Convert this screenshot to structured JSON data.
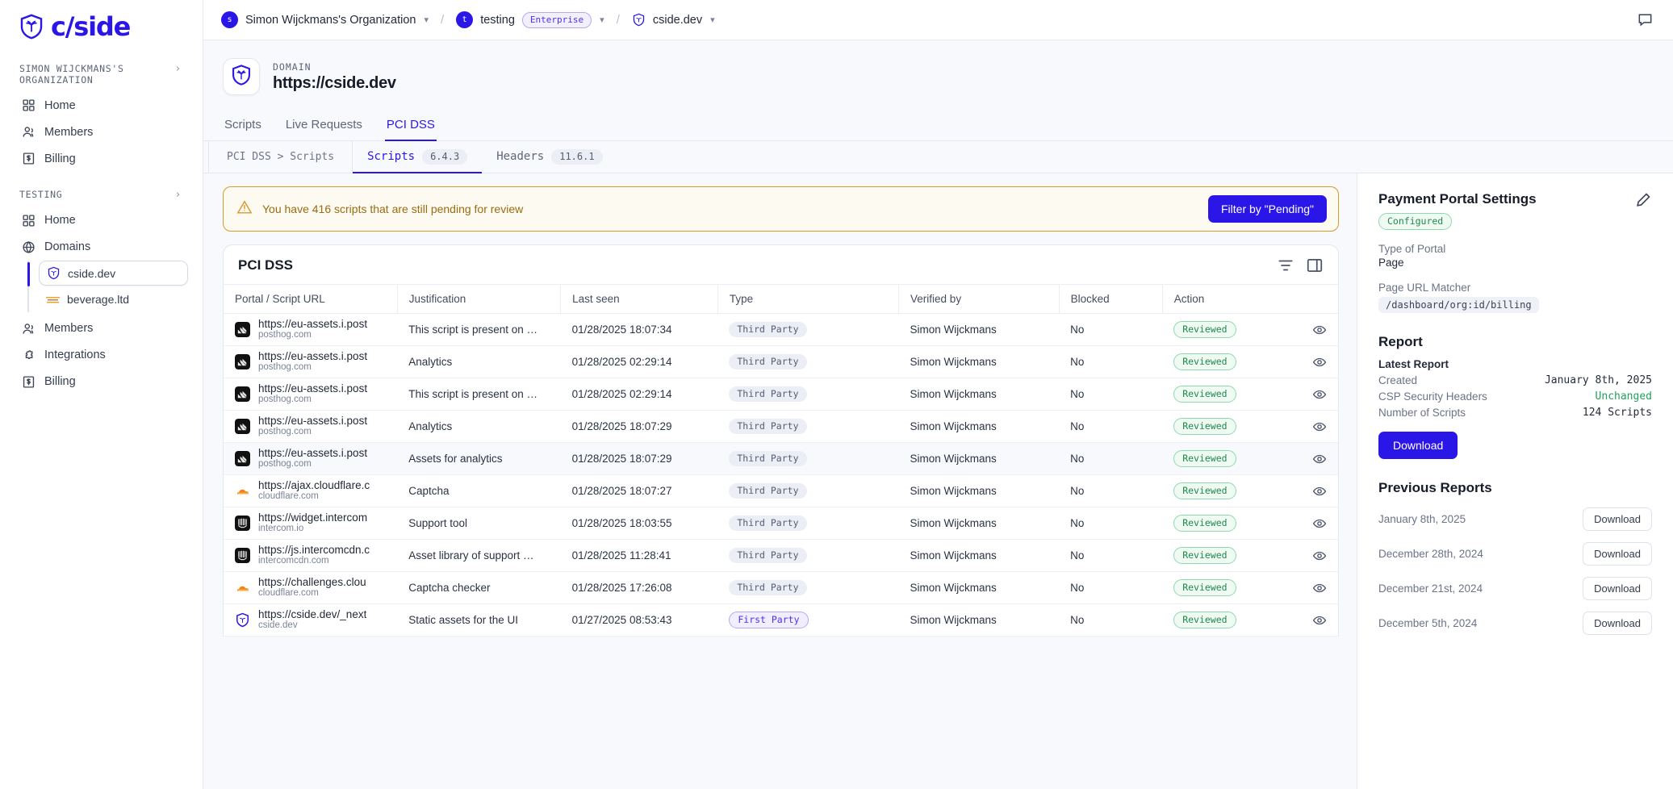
{
  "sidebar": {
    "logo_text": "c/side",
    "org_section": {
      "label": "SIMON WIJCKMANS'S ORGANIZATION"
    },
    "org_items": [
      {
        "label": "Home",
        "icon": "grid-icon"
      },
      {
        "label": "Members",
        "icon": "people-icon"
      },
      {
        "label": "Billing",
        "icon": "receipt-dollar-icon"
      }
    ],
    "project_section": {
      "label": "TESTING"
    },
    "project_items": [
      {
        "label": "Home",
        "icon": "grid-icon"
      },
      {
        "label": "Domains",
        "icon": "globe-icon"
      }
    ],
    "domains": [
      {
        "label": "cside.dev",
        "icon": "cside-shield-icon",
        "active": true
      },
      {
        "label": "beverage.ltd",
        "icon": "beverage-favicon",
        "active": false
      }
    ],
    "project_items_2": [
      {
        "label": "Members",
        "icon": "people-icon"
      },
      {
        "label": "Integrations",
        "icon": "puzzle-icon"
      },
      {
        "label": "Billing",
        "icon": "receipt-dollar-icon"
      }
    ]
  },
  "topbar": {
    "org": {
      "initial": "s",
      "name": "Simon Wijckmans's Organization"
    },
    "project": {
      "initial": "t",
      "name": "testing",
      "plan": "Enterprise"
    },
    "domain": {
      "name": "cside.dev"
    },
    "separator": "/",
    "feedback_icon": "feedback-icon"
  },
  "page": {
    "kicker": "DOMAIN",
    "title": "https://cside.dev",
    "tabs": [
      {
        "label": "Scripts",
        "active": false
      },
      {
        "label": "Live Requests",
        "active": false
      },
      {
        "label": "PCI DSS",
        "active": true
      }
    ],
    "subcrumb": "PCI DSS > Scripts",
    "subtabs": [
      {
        "label": "Scripts",
        "chip": "6.4.3",
        "active": true
      },
      {
        "label": "Headers",
        "chip": "11.6.1",
        "active": false
      }
    ]
  },
  "banner": {
    "icon": "warning-triangle-icon",
    "text": "You have 416 scripts that are still pending for review",
    "button": "Filter by \"Pending\""
  },
  "table": {
    "title": "PCI DSS",
    "tools": [
      {
        "name": "filter-icon"
      },
      {
        "name": "panel-toggle-icon"
      }
    ],
    "columns": [
      "Portal / Script URL",
      "Justification",
      "Last seen",
      "Type",
      "Verified by",
      "Blocked",
      "Action"
    ],
    "rows": [
      {
        "url": "https://eu-assets.i.post",
        "host": "posthog.com",
        "favicon": "posthog-icon",
        "justification": "This script is present on …",
        "last_seen": "01/28/2025 18:07:34",
        "type": "Third Party",
        "verified_by": "Simon Wijckmans",
        "blocked": "No",
        "action": "Reviewed"
      },
      {
        "url": "https://eu-assets.i.post",
        "host": "posthog.com",
        "favicon": "posthog-icon",
        "justification": "Analytics",
        "last_seen": "01/28/2025 02:29:14",
        "type": "Third Party",
        "verified_by": "Simon Wijckmans",
        "blocked": "No",
        "action": "Reviewed"
      },
      {
        "url": "https://eu-assets.i.post",
        "host": "posthog.com",
        "favicon": "posthog-icon",
        "justification": "This script is present on …",
        "last_seen": "01/28/2025 02:29:14",
        "type": "Third Party",
        "verified_by": "Simon Wijckmans",
        "blocked": "No",
        "action": "Reviewed"
      },
      {
        "url": "https://eu-assets.i.post",
        "host": "posthog.com",
        "favicon": "posthog-icon",
        "justification": "Analytics",
        "last_seen": "01/28/2025 18:07:29",
        "type": "Third Party",
        "verified_by": "Simon Wijckmans",
        "blocked": "No",
        "action": "Reviewed"
      },
      {
        "url": "https://eu-assets.i.post",
        "host": "posthog.com",
        "favicon": "posthog-icon",
        "justification": "Assets for analytics",
        "last_seen": "01/28/2025 18:07:29",
        "type": "Third Party",
        "verified_by": "Simon Wijckmans",
        "blocked": "No",
        "action": "Reviewed"
      },
      {
        "url": "https://ajax.cloudflare.c",
        "host": "cloudflare.com",
        "favicon": "cloudflare-icon",
        "justification": "Captcha",
        "last_seen": "01/28/2025 18:07:27",
        "type": "Third Party",
        "verified_by": "Simon Wijckmans",
        "blocked": "No",
        "action": "Reviewed"
      },
      {
        "url": "https://widget.intercom",
        "host": "intercom.io",
        "favicon": "intercom-icon",
        "justification": "Support tool",
        "last_seen": "01/28/2025 18:03:55",
        "type": "Third Party",
        "verified_by": "Simon Wijckmans",
        "blocked": "No",
        "action": "Reviewed"
      },
      {
        "url": "https://js.intercomcdn.c",
        "host": "intercomcdn.com",
        "favicon": "intercom-icon",
        "justification": "Asset library of support …",
        "last_seen": "01/28/2025 11:28:41",
        "type": "Third Party",
        "verified_by": "Simon Wijckmans",
        "blocked": "No",
        "action": "Reviewed"
      },
      {
        "url": "https://challenges.clou",
        "host": "cloudflare.com",
        "favicon": "cloudflare-icon",
        "justification": "Captcha checker",
        "last_seen": "01/28/2025 17:26:08",
        "type": "Third Party",
        "verified_by": "Simon Wijckmans",
        "blocked": "No",
        "action": "Reviewed"
      },
      {
        "url": "https://cside.dev/_next",
        "host": "cside.dev",
        "favicon": "cside-shield-icon",
        "justification": "Static assets for the UI",
        "last_seen": "01/27/2025 08:53:43",
        "type": "First Party",
        "verified_by": "Simon Wijckmans",
        "blocked": "No",
        "action": "Reviewed"
      }
    ]
  },
  "right_panel": {
    "settings": {
      "title": "Payment Portal Settings",
      "edit_icon": "pencil-icon",
      "status": "Configured",
      "type_label": "Type of Portal",
      "type_value": "Page",
      "matcher_label": "Page URL Matcher",
      "matcher_value": "/dashboard/org:id/billing"
    },
    "report": {
      "title": "Report",
      "latest_label": "Latest Report",
      "fields": [
        {
          "key": "Created",
          "value": "January 8th, 2025",
          "green": false
        },
        {
          "key": "CSP Security Headers",
          "value": "Unchanged",
          "green": true
        },
        {
          "key": "Number of Scripts",
          "value": "124 Scripts",
          "green": false
        }
      ],
      "download_button": "Download"
    },
    "previous": {
      "title": "Previous Reports",
      "items": [
        {
          "date": "January 8th, 2025",
          "button": "Download"
        },
        {
          "date": "December 28th, 2024",
          "button": "Download"
        },
        {
          "date": "December 21st, 2024",
          "button": "Download"
        },
        {
          "date": "December 5th, 2024",
          "button": "Download"
        }
      ]
    }
  },
  "colors": {
    "accent": "#2b16e8",
    "warning": "#d79a2b",
    "success": "#22a15c"
  }
}
